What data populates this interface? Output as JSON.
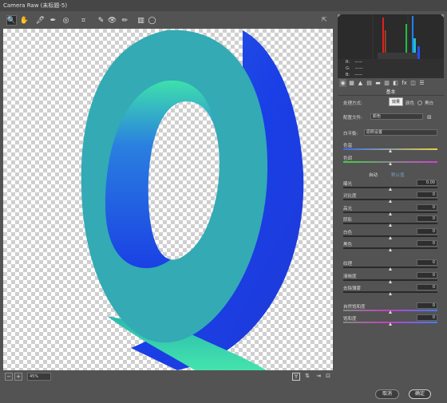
{
  "window": {
    "title": "Camera Raw (未标题-5)"
  },
  "toolbar": {
    "tools": [
      {
        "name": "zoom-tool",
        "glyph": "🔍"
      },
      {
        "name": "hand-tool",
        "glyph": "✋"
      },
      {
        "name": "white-balance-tool",
        "glyph": "🖋"
      },
      {
        "name": "color-sampler-tool",
        "glyph": "✒"
      },
      {
        "name": "target-adjustment-tool",
        "glyph": "◎"
      },
      {
        "name": "crop-tool",
        "glyph": "⌗"
      },
      {
        "name": "spot-removal-tool",
        "glyph": "✎"
      },
      {
        "name": "red-eye-tool",
        "glyph": "👁"
      },
      {
        "name": "adjustment-brush-tool",
        "glyph": "✏"
      },
      {
        "name": "graduated-filter-tool",
        "glyph": "▥"
      },
      {
        "name": "radial-filter-tool",
        "glyph": "◯"
      }
    ]
  },
  "statusbar": {
    "zoom": "45%",
    "y_label": "Y"
  },
  "histogram": {
    "r": "R:",
    "g": "G:",
    "b": "B:",
    "r_val": "——",
    "g_val": "——",
    "b_val": "——"
  },
  "panel": {
    "tooltip": "效果",
    "section_title": "基本",
    "treatment_label": "处理方式:",
    "treatment_color": "颜色",
    "treatment_bw": "黑白",
    "profile_label": "配置文件:",
    "profile_value": "颜色",
    "wb_label": "白平衡:",
    "wb_value": "原照设置",
    "auto": "自动",
    "default": "默认值",
    "sliders": [
      {
        "label": "色温",
        "value": "",
        "pos": 0.5,
        "track": "temp"
      },
      {
        "label": "色调",
        "value": "",
        "pos": 0.5,
        "track": "tint"
      },
      {
        "label": "曝光",
        "value": "0.00",
        "pos": 0.5,
        "track": "plain"
      },
      {
        "label": "对比度",
        "value": "0",
        "pos": 0.5,
        "track": "plain"
      },
      {
        "label": "高光",
        "value": "0",
        "pos": 0.5,
        "track": "plain"
      },
      {
        "label": "阴影",
        "value": "0",
        "pos": 0.5,
        "track": "plain"
      },
      {
        "label": "白色",
        "value": "0",
        "pos": 0.5,
        "track": "plain"
      },
      {
        "label": "黑色",
        "value": "0",
        "pos": 0.5,
        "track": "plain"
      },
      {
        "label": "纹理",
        "value": "0",
        "pos": 0.5,
        "track": "plain"
      },
      {
        "label": "清晰度",
        "value": "0",
        "pos": 0.5,
        "track": "plain"
      },
      {
        "label": "去除薄雾",
        "value": "0",
        "pos": 0.5,
        "track": "plain"
      },
      {
        "label": "自然饱和度",
        "value": "0",
        "pos": 0.5,
        "track": "vib"
      },
      {
        "label": "饱和度",
        "value": "0",
        "pos": 0.5,
        "track": "sat"
      }
    ]
  },
  "footer": {
    "cancel": "取消",
    "ok": "确定"
  },
  "colors": {
    "ring_teal": "#33aab4",
    "ring_blue": "#1a44e0",
    "ring_green": "#3ee0ac"
  }
}
